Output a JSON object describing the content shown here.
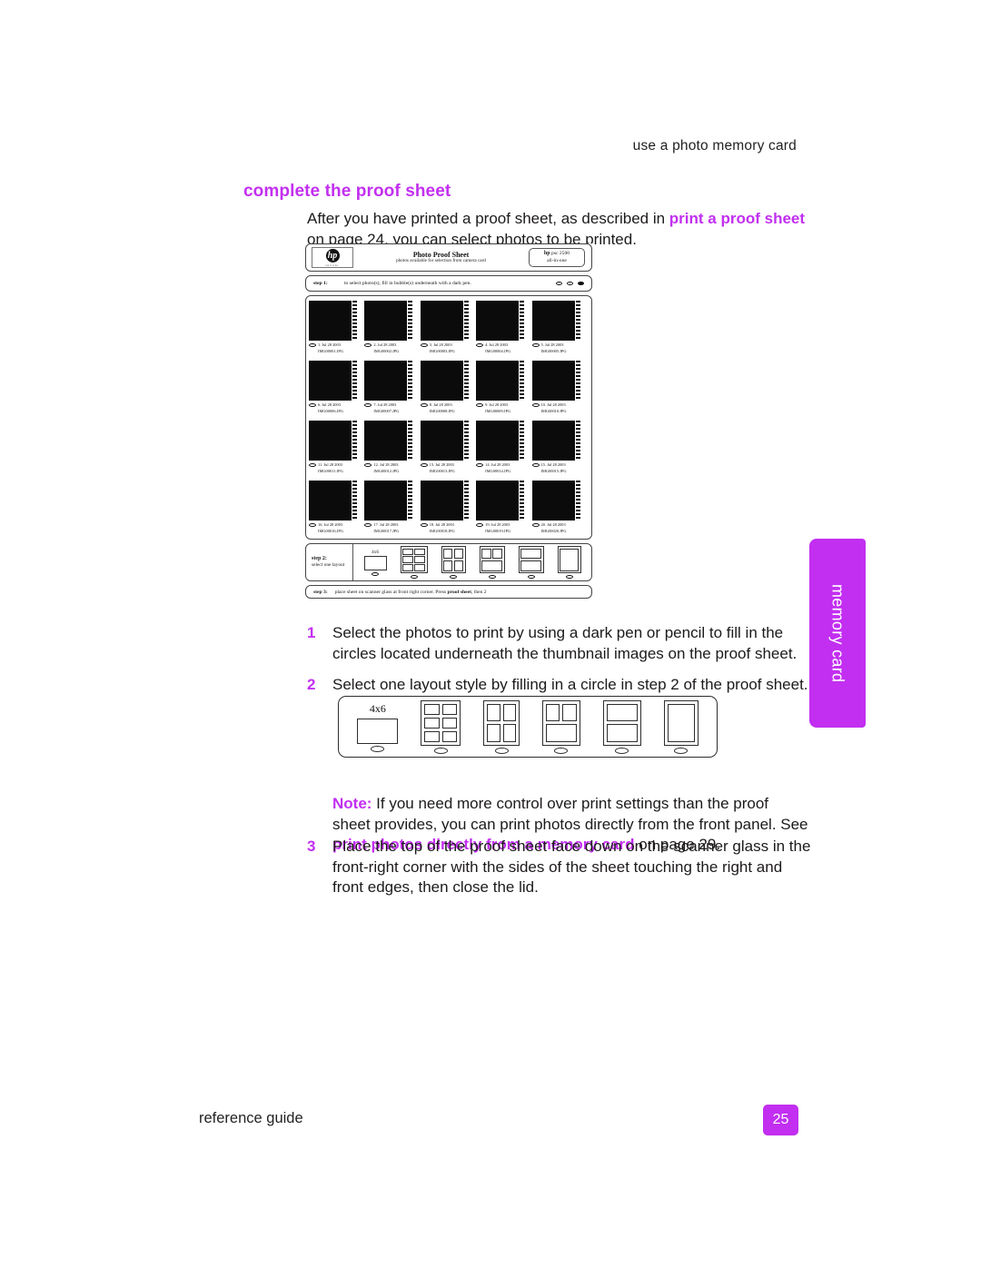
{
  "page": {
    "running_head": "use a photo memory card",
    "footer_label": "reference guide",
    "page_number": "25",
    "side_tab": "memory card",
    "accent_color": "#c22ff0"
  },
  "section": {
    "heading": "complete the proof sheet",
    "intro_before": "After you have printed a proof sheet, as described in ",
    "intro_xref": "print a proof sheet",
    "intro_after": " on page 24, you can select photos to be printed."
  },
  "proof_sheet": {
    "brand": "hp",
    "brand_tagline": "invent",
    "title": "Photo Proof Sheet",
    "subtitle": "photos available for selection from camera card",
    "model_brand": "hp",
    "model_name": "psc 2500",
    "model_line": "all-in-one",
    "step1_label": "step 1:",
    "step1_text": "to select photo(s), fill in bubble(s) underneath with a dark pen.",
    "step2_label": "step 2:",
    "step2_sub": "select one layout",
    "step2_caption": "4x6",
    "step3_label": "step 3:",
    "step3_text_before": "place sheet on scanner glass at front right corner. Press ",
    "step3_text_bold": "proof sheet",
    "step3_text_after": ", then 2",
    "thumbnails": [
      {
        "num": "1",
        "date": "Jul 28 2003",
        "file": "IMG00001.JPG",
        "img": "img-a"
      },
      {
        "num": "2",
        "date": "Jul 28 2003",
        "file": "IMG00002.JPG",
        "img": "img-b"
      },
      {
        "num": "3",
        "date": "Jul 28 2003",
        "file": "IMG00003.JPG",
        "img": "img-c"
      },
      {
        "num": "4",
        "date": "Jul 28 2003",
        "file": "IMG00004.JPG",
        "img": "img-d"
      },
      {
        "num": "5",
        "date": "Jul 28 2003",
        "file": "IMG00005.JPG",
        "img": "img-e"
      },
      {
        "num": "6",
        "date": "Jul 28 2003",
        "file": "IMG00006.JPG",
        "img": "img-f"
      },
      {
        "num": "7",
        "date": "Jul 28 2003",
        "file": "IMG00007.JPG",
        "img": "img-g"
      },
      {
        "num": "8",
        "date": "Jul 28 2003",
        "file": "IMG00008.JPG",
        "img": "img-h"
      },
      {
        "num": "9",
        "date": "Jul 28 2003",
        "file": "IMG00009.JPG",
        "img": "img-i"
      },
      {
        "num": "10",
        "date": "Jul 28 2003",
        "file": "IMG00010.JPG",
        "img": "img-j"
      },
      {
        "num": "11",
        "date": "Jul 28 2003",
        "file": "IMG00011.JPG",
        "img": "img-k"
      },
      {
        "num": "12",
        "date": "Jul 28 2003",
        "file": "IMG00012.JPG",
        "img": "img-l"
      },
      {
        "num": "13",
        "date": "Jul 28 2003",
        "file": "IMG00013.JPG",
        "img": "img-m"
      },
      {
        "num": "14",
        "date": "Jul 28 2003",
        "file": "IMG00014.JPG",
        "img": "img-n"
      },
      {
        "num": "15",
        "date": "Jul 28 2003",
        "file": "IMG00015.JPG",
        "img": "img-o"
      },
      {
        "num": "16",
        "date": "Jul 28 2003",
        "file": "IMG00016.JPG",
        "img": "img-p"
      },
      {
        "num": "17",
        "date": "Jul 28 2003",
        "file": "IMG00017.JPG",
        "img": "img-q"
      },
      {
        "num": "18",
        "date": "Jul 28 2003",
        "file": "IMG00018.JPG",
        "img": "img-r"
      },
      {
        "num": "19",
        "date": "Jul 28 2003",
        "file": "IMG00019.JPG",
        "img": "img-s"
      },
      {
        "num": "20",
        "date": "Jul 28 2003",
        "file": "IMG00020.JPG",
        "img": "img-t"
      }
    ]
  },
  "layout_figure": {
    "caption": "4x6",
    "options": [
      {
        "name": "single-4x6"
      },
      {
        "name": "six-up"
      },
      {
        "name": "four-up"
      },
      {
        "name": "three-up"
      },
      {
        "name": "two-up"
      },
      {
        "name": "full-page"
      }
    ]
  },
  "steps": [
    {
      "num": "1",
      "text": "Select the photos to print by using a dark pen or pencil to fill in the circles located underneath the thumbnail images on the proof sheet."
    },
    {
      "num": "2",
      "text": "Select one layout style by filling in a circle in step 2 of the proof sheet."
    }
  ],
  "note": {
    "lead": "Note:",
    "text_before": " If you need more control over print settings than the proof sheet provides, you can print photos directly from the front panel. See ",
    "xref": "print photos directly from a memory card",
    "text_after": " on page 29."
  },
  "step3": {
    "num": "3",
    "text": "Place the top of the proof sheet face down on the scanner glass in the front-right corner with the sides of the sheet touching the right and front edges, then close the lid."
  }
}
